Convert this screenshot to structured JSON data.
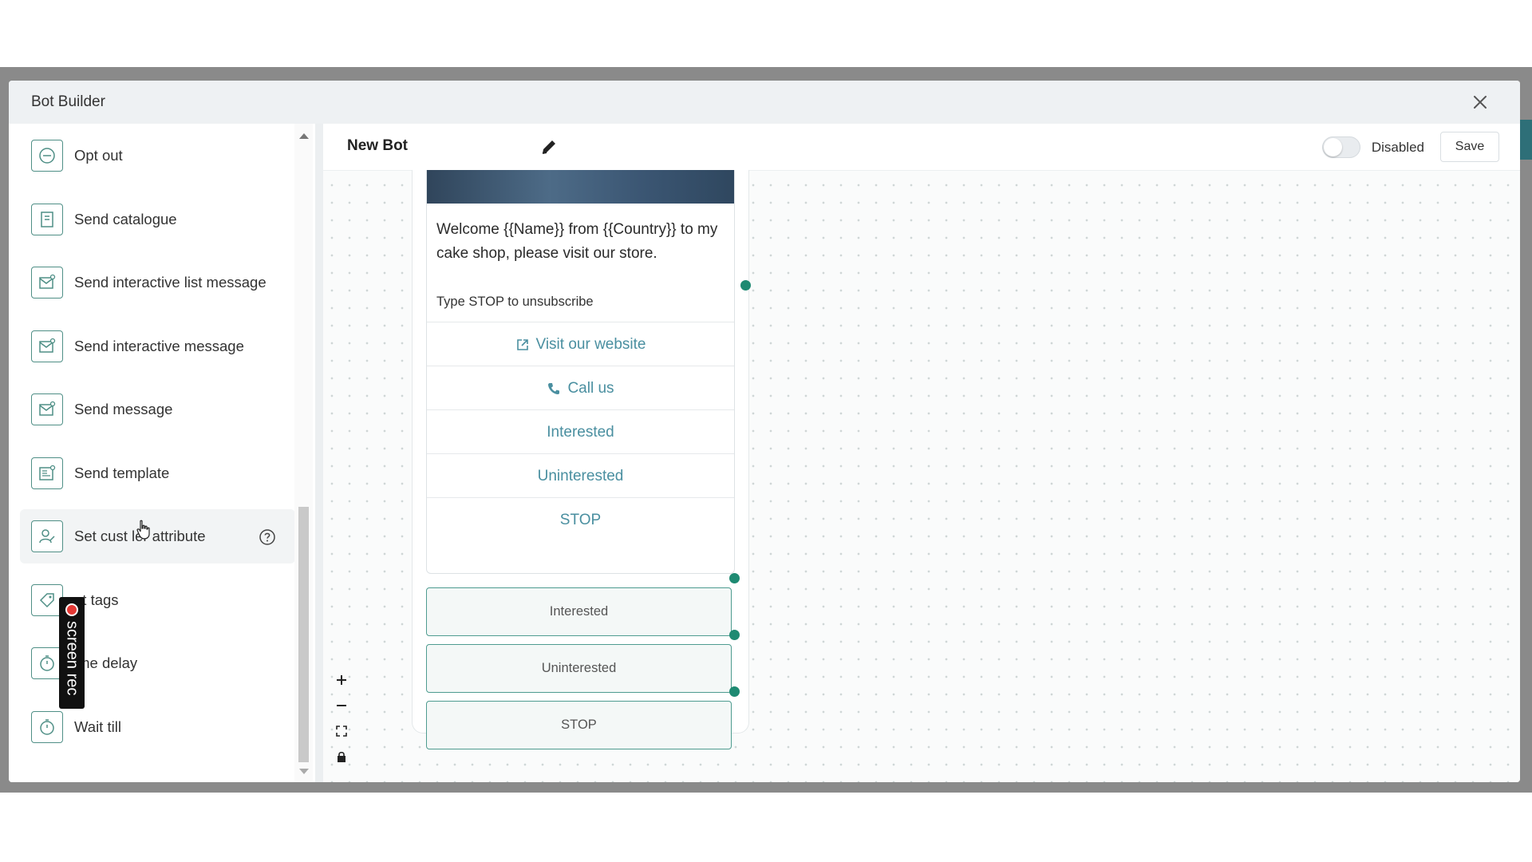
{
  "modal": {
    "title": "Bot Builder"
  },
  "sidebar": {
    "items": [
      {
        "label": "Opt out",
        "icon": "opt-out-icon"
      },
      {
        "label": "Send catalogue",
        "icon": "catalogue-icon"
      },
      {
        "label": "Send interactive list message",
        "icon": "message-icon"
      },
      {
        "label": "Send interactive message",
        "icon": "message-icon"
      },
      {
        "label": "Send message",
        "icon": "message-icon"
      },
      {
        "label": "Send template",
        "icon": "template-icon"
      },
      {
        "label": "Set cust   ler attribute",
        "icon": "user-attribute-icon",
        "help_icon": "help-icon"
      },
      {
        "label": "et tags",
        "icon": "tag-icon"
      },
      {
        "label": "ime delay",
        "icon": "timer-icon"
      },
      {
        "label": "Wait till",
        "icon": "timer-icon"
      }
    ]
  },
  "topbar": {
    "bot_name": "New Bot",
    "toggle_label": "Disabled",
    "save_label": "Save"
  },
  "node": {
    "message_text": "Welcome {{Name}} from {{Country}} to my cake shop, please visit our store.",
    "footer": "Type STOP to unsubscribe",
    "buttons": [
      {
        "label": "Visit our website",
        "icon": "external-link-icon"
      },
      {
        "label": "Call us",
        "icon": "phone-icon"
      },
      {
        "label": "Interested"
      },
      {
        "label": "Uninterested"
      },
      {
        "label": "STOP"
      }
    ],
    "replies": [
      "Interested",
      "Uninterested",
      "STOP"
    ]
  },
  "colors": {
    "accent": "#1e8a72",
    "link": "#4a8fa0",
    "border_accent": "#4e9c90"
  },
  "overlay": {
    "screenrec_label": "screen rec"
  }
}
